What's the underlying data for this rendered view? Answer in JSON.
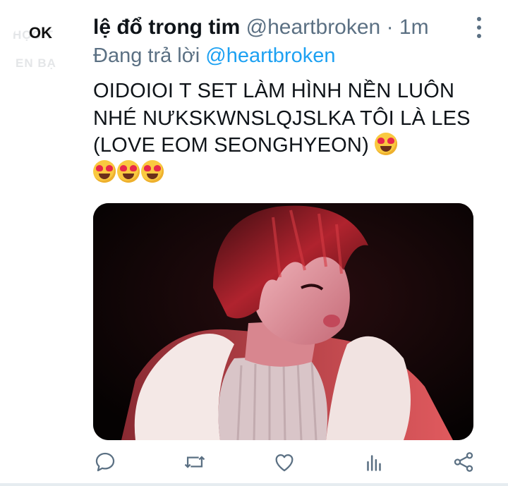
{
  "avatar": {
    "label": "OK",
    "ghost_line_1": "HỌC T",
    "ghost_line_2": "EN BẠ"
  },
  "tweet": {
    "display_name": "lệ đổ trong tim",
    "handle": "@heartbroken",
    "separator": "·",
    "time": "1m",
    "reply_prefix": "Đang trả lời",
    "reply_handle": "@heartbroken",
    "text": "OIDOIOI T SET LÀM HÌNH NỀN LUÔN NHÉ NƯKSKWNSLQJSLKA TÔI LÀ LES (LOVE EOM SEONGHYEON)",
    "emoji_count": 4,
    "emoji_name": "star-struck-heart-eyes-emoji"
  },
  "actions": [
    {
      "name": "reply-button",
      "icon": "comment-icon"
    },
    {
      "name": "retweet-button",
      "icon": "retweet-icon"
    },
    {
      "name": "like-button",
      "icon": "heart-icon"
    },
    {
      "name": "analytics-button",
      "icon": "bar-chart-icon"
    },
    {
      "name": "share-button",
      "icon": "share-icon"
    }
  ],
  "colors": {
    "text": "#0f1419",
    "secondary": "#5b7083",
    "link": "#1da1f2",
    "emoji": "#f9c940",
    "heart": "#e8284a"
  }
}
